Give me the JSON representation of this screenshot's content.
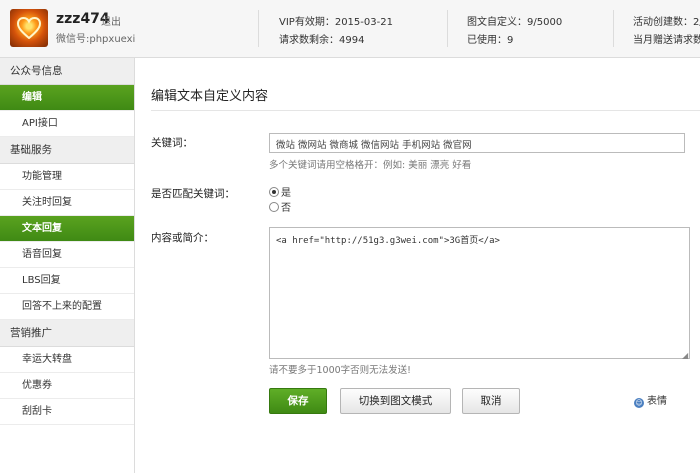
{
  "header": {
    "username": "zzz474",
    "logout": "退出",
    "wechat_id": "微信号:phpxuexi",
    "stats": [
      {
        "label": "VIP有效期：",
        "value": "2015-03-21"
      },
      {
        "label": "请求数剩余：",
        "value": "4994"
      },
      {
        "label": "图文自定义：",
        "value": "9/5000"
      },
      {
        "label": "已使用：",
        "value": "9"
      },
      {
        "label": "活动创建数：",
        "value": "2/"
      },
      {
        "label": "当月赠送请求数",
        "value": ""
      }
    ]
  },
  "sidebar": {
    "sections": [
      {
        "title": "公众号信息",
        "items": [
          "编辑",
          "API接口"
        ]
      },
      {
        "title": "基础服务",
        "items": [
          "功能管理",
          "关注时回复",
          "文本回复",
          "语音回复",
          "LBS回复",
          "回答不上来的配置"
        ]
      },
      {
        "title": "营销推广",
        "items": [
          "幸运大转盘",
          "优惠券",
          "刮刮卡"
        ]
      }
    ],
    "active_items": [
      "编辑",
      "文本回复"
    ]
  },
  "main": {
    "title": "编辑文本自定义内容",
    "keyword_label": "关键词：",
    "keyword_value": "微站 微网站 微商城 微信网站 手机网站 微官网",
    "keyword_hint": "多个关键词请用空格格开：例如: 美丽 漂亮 好看",
    "match_label": "是否匹配关键词：",
    "radio_yes": "是",
    "radio_no": "否",
    "content_label": "内容或简介：",
    "content_value": "<a href=\"http://51g3.g3wei.com\">3G首页</a>",
    "content_hint": "请不要多于1000字否则无法发送!",
    "save_label": "保存",
    "switch_label": "切换到图文模式",
    "cancel_label": "取消",
    "emoji_label": "表情"
  }
}
